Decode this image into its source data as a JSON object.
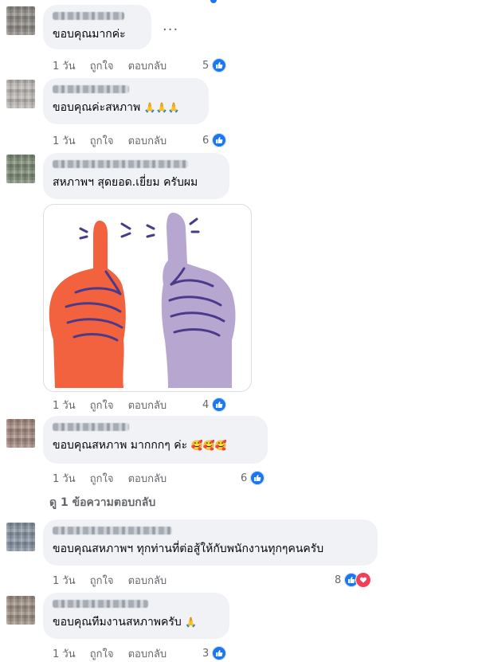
{
  "common": {
    "age": "1 วัน",
    "like_label": "ถูกใจ",
    "reply_label": "ตอบกลับ",
    "more_label": "..."
  },
  "comments": [
    {
      "text": "ขอบคุณมากค่ะ",
      "count": "5",
      "emoji": ""
    },
    {
      "text": "ขอบคุณค่ะสหภาพ",
      "count": "6",
      "emoji": "🙏🙏🙏"
    },
    {
      "text": "สหภาพฯ สุดยอด.เยี่ยม ครับผม",
      "count": "4",
      "emoji": "",
      "sticker": "thumbs-up-sticker"
    },
    {
      "text": "ขอบคุณสหภาพ มากกกๆ ค่ะ",
      "count": "6",
      "emoji": "🥰🥰🥰"
    },
    {
      "text": "ขอบคุณสหภาพฯ ทุกท่านที่ต่อสู้ให้กับพนักงานทุกๆคนครับ",
      "count": "8",
      "emoji": ""
    },
    {
      "text": "ขอบคุณทีมงานสหภาพครับ",
      "count": "3",
      "emoji": "🙏"
    }
  ],
  "view_replies": "ดู 1 ข้อความตอบกลับ",
  "colors": {
    "bubble": "#f0f2f5",
    "like_blue": "#1877f2",
    "love_red": "#f33e58",
    "meta_gray": "#65676b",
    "sticker_orange": "#f2623e",
    "sticker_lavender": "#b7a6cf",
    "sticker_lines": "#4b3a8a"
  },
  "icons": [
    "like-icon",
    "love-icon",
    "more-icon"
  ]
}
